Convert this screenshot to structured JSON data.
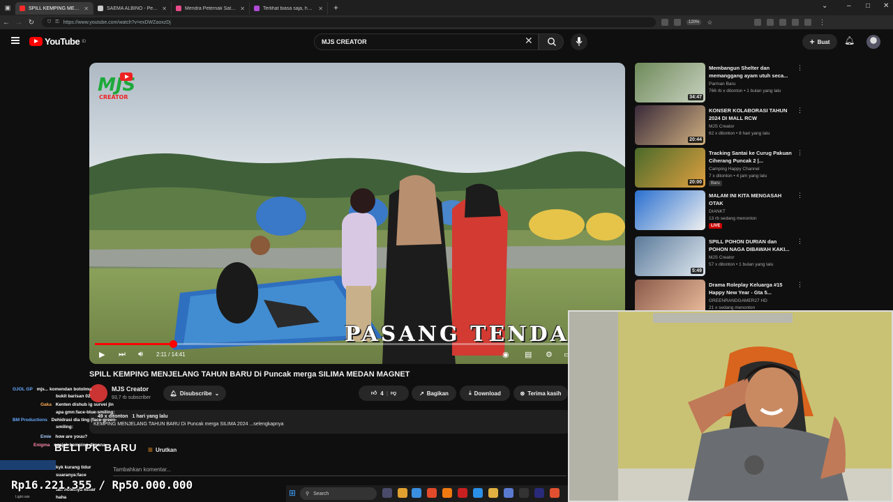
{
  "browser": {
    "tabs": [
      {
        "label": "SPILL KEMPING MENJELANG TA",
        "color": "#ff2b2b",
        "active": true
      },
      {
        "label": "SAEMA ALBINO - Pendaunan G",
        "color": "#cccccc",
        "active": false
      },
      {
        "label": "Mendra Peternak Sato | Veransa",
        "color": "#e84b8a",
        "active": false
      },
      {
        "label": "Terlihat biasa saja, hewan hewan",
        "color": "#b04bd8",
        "active": false
      }
    ],
    "new_tab": "+",
    "url": "https://www.youtube.com/watch?v=exDWZaoxzDj",
    "zoom": "120%"
  },
  "youtube": {
    "logo_text": "YouTube",
    "logo_sup": "ID",
    "search_value": "MJS CREATOR",
    "create_label": "Buat"
  },
  "player": {
    "overlay_text": "PASANG TENDA",
    "channel_logo_text": "MJS",
    "channel_logo_sub": "CREATOR",
    "time_current": "2:11",
    "time_total": "14:41",
    "progress": 0.149
  },
  "video": {
    "title": "SPILL KEMPING MENJELANG TAHUN BARU Di Puncak merga SILIMA MEDAN MAGNET",
    "channel": "MJS Creator",
    "subscribers": "93,7 rb subscriber",
    "subscribe_label": "Disubscribe",
    "likes": "4",
    "share_label": "Bagikan",
    "download_label": "Download",
    "thanks_label": "Terima kasih",
    "views": "49 x ditonton",
    "uploaded": "1 hari yang lalu",
    "description": "KEMPING MENJELANG TAHUN BARU Di Puncak merga SILIMA 2024 ...selengkapnya",
    "comments_heading": "BELI PK BARU",
    "sort_label": "Urutkan",
    "comment_placeholder": "Tambahkan komentar..."
  },
  "recommendations": [
    {
      "title": "Membangun Shelter dan memanggang ayam utuh seca...",
      "channel": "Parman Baru",
      "meta": "766 rb x ditonton • 1 bulan yang lalu",
      "duration": "34:47",
      "badge": "",
      "colors": [
        "#6f8a5a",
        "#c8d2c0"
      ]
    },
    {
      "title": "KONSER KOLABORASI TAHUN 2024 DI MALL RCW",
      "channel": "MJS Creator",
      "meta": "62 x ditonton • 8 hari yang lalu",
      "duration": "20:44",
      "badge": "",
      "colors": [
        "#3a2a3a",
        "#d0b080"
      ]
    },
    {
      "title": "Tracking Santai ke Curug Pakuan Ciherang Puncak 2 |...",
      "channel": "Camping Happy Channel",
      "meta": "7 x ditonton • 4 jam yang lalu",
      "duration": "20:00",
      "badge": "Baru",
      "colors": [
        "#4a6a2a",
        "#e0a040"
      ]
    },
    {
      "title": "MALAM INI KITA MENGASAH OTAK",
      "channel": "DIANKT",
      "meta": "13 rb sedang menonton",
      "duration": "",
      "badge": "LIVE",
      "colors": [
        "#2a70d0",
        "#f0f0f0"
      ]
    },
    {
      "title": "SPILL POHON DURIAN dan POHON NAGA DIBAWAH KAKI...",
      "channel": "MJS Creator",
      "meta": "57 x ditonton • 1 bulan yang lalu",
      "duration": "5:49",
      "badge": "",
      "colors": [
        "#5a7a9a",
        "#e0e8f0"
      ]
    },
    {
      "title": "Drama Roleplay Keluarga #15 Happy New Year - Gta 5...",
      "channel": "GREENRANDGAMER27 HD",
      "meta": "21 x sedang menonton",
      "duration": "",
      "badge": "",
      "colors": [
        "#8a5a4a",
        "#f0c0a0"
      ]
    }
  ],
  "chat": [
    {
      "name": "OJOL GP",
      "color": "#66aaff",
      "text": "mjs... komendan botolmu"
    },
    {
      "name": "",
      "color": "#ffffff",
      "text": "bukit barisan 02"
    },
    {
      "name": "Gaka",
      "color": "#ffaa55",
      "text": "Kenten dishub ig survei jln"
    },
    {
      "name": "",
      "color": "#ffffff",
      "text": "apa gmn:face-blue-smiling:"
    },
    {
      "name": "BM Productions",
      "color": "#66aaff",
      "text": "Dehidrasi dia ting (face-green-"
    },
    {
      "name": "",
      "color": "#ffffff",
      "text": "smiling:"
    },
    {
      "name": "Emie",
      "color": "#aaccff",
      "text": "how are youu?"
    },
    {
      "name": "Enigma",
      "color": "#ff88aa",
      "text": "ngajak kemping dimana"
    },
    {
      "name": "",
      "color": "#ffffff",
      "text": "kyk kurang tidur"
    },
    {
      "name": "",
      "color": "#ffffff",
      "text": "suaranya:face"
    },
    {
      "name": "",
      "color": "#ffffff",
      "text": "tan hotelnya keliar"
    },
    {
      "name": "",
      "color": "#ffffff",
      "text": "haha"
    }
  ],
  "donation": "Rp16.221.355 / Rp50.000.000",
  "chat_footer": "Light rain",
  "taskbar": {
    "search_label": "Search"
  }
}
